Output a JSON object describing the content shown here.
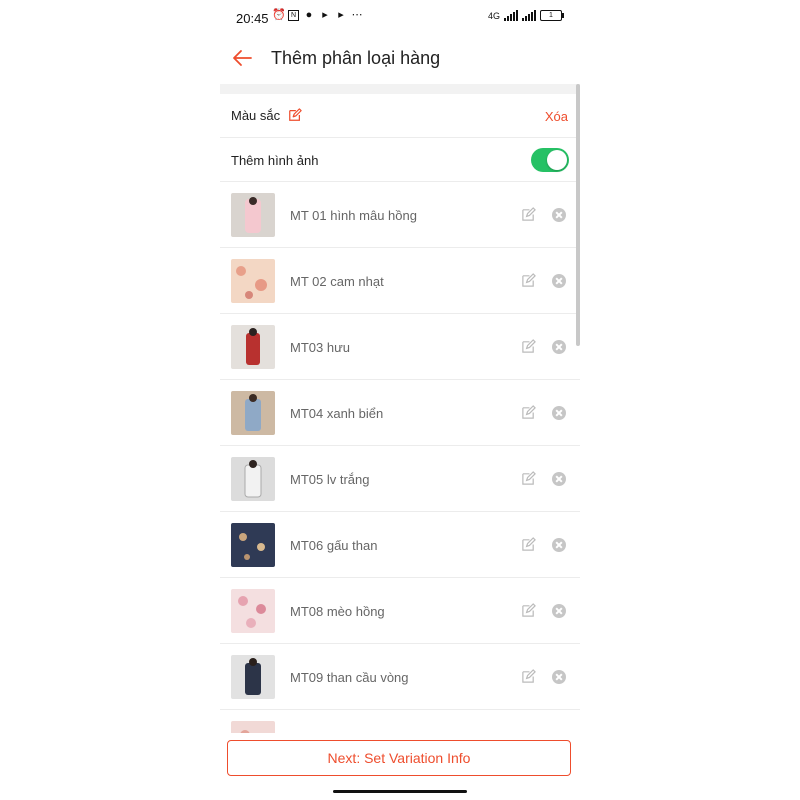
{
  "status_bar": {
    "time": "20:45",
    "network": "4G",
    "battery": "1"
  },
  "header": {
    "title": "Thêm phân loại hàng"
  },
  "attribute": {
    "label": "Màu sắc",
    "delete_label": "Xóa"
  },
  "image_toggle": {
    "label": "Thêm hình ảnh",
    "enabled": true
  },
  "items": [
    {
      "label": "MT 01 hình mâu hồng"
    },
    {
      "label": "MT 02 cam nhạt"
    },
    {
      "label": "MT03 hưu"
    },
    {
      "label": "MT04 xanh biển"
    },
    {
      "label": "MT05 lv trắng"
    },
    {
      "label": "MT06 gấu than"
    },
    {
      "label": "MT08 mèo hồng"
    },
    {
      "label": "MT09 than cầu vòng"
    }
  ],
  "footer": {
    "next_label": "Next: Set Variation Info"
  },
  "colors": {
    "accent": "#ee4d2d",
    "toggle_on": "#26c165"
  }
}
